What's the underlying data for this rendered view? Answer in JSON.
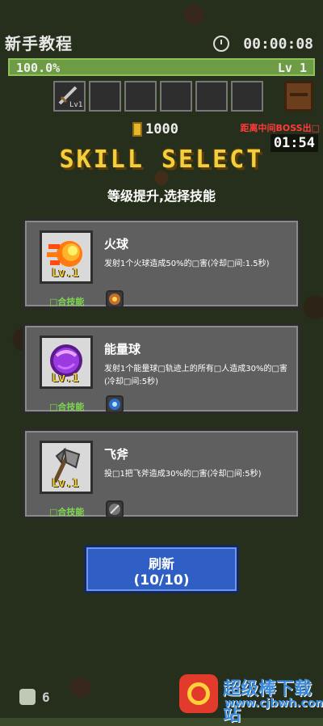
{
  "hud": {
    "title": "新手教程",
    "timer": "00:00:08",
    "xp_percent_text": "100.0%",
    "xp_fraction": 1.0,
    "level_text": "Lv 1",
    "coins": "1000",
    "boss_label": "距离中间BOSS出□",
    "boss_countdown": "01:54",
    "slot_weapon_level": "Lv1"
  },
  "header": {
    "title": "SKILL SELECT",
    "subtitle": "等级提升,选择技能"
  },
  "skills": [
    {
      "name": "火球",
      "level": "Lv.1",
      "description": "发射1个火球造成50%的□害(冷却□间:1.5秒)",
      "combo_label": "□合技能",
      "icon": "fireball-icon",
      "color": "#ff9a1a"
    },
    {
      "name": "能量球",
      "level": "Lv.1",
      "description": "发射1个能量球□轨迹上的所有□人造成30%的□害(冷却□间:5秒)",
      "combo_label": "□合技能",
      "icon": "energy-ball-icon",
      "color": "#a23fe0"
    },
    {
      "name": "飞斧",
      "level": "Lv.1",
      "description": "投□1把飞斧造成30%的□害(冷却□间:5秒)",
      "combo_label": "□合技能",
      "icon": "axe-icon",
      "color": "#8a8a8a"
    }
  ],
  "refresh": {
    "label": "刷新",
    "count": "(10/10)"
  },
  "footer": {
    "kills": "6"
  },
  "watermark": {
    "text": "超级棒下载站",
    "sub": "www.cjbwh.com"
  }
}
